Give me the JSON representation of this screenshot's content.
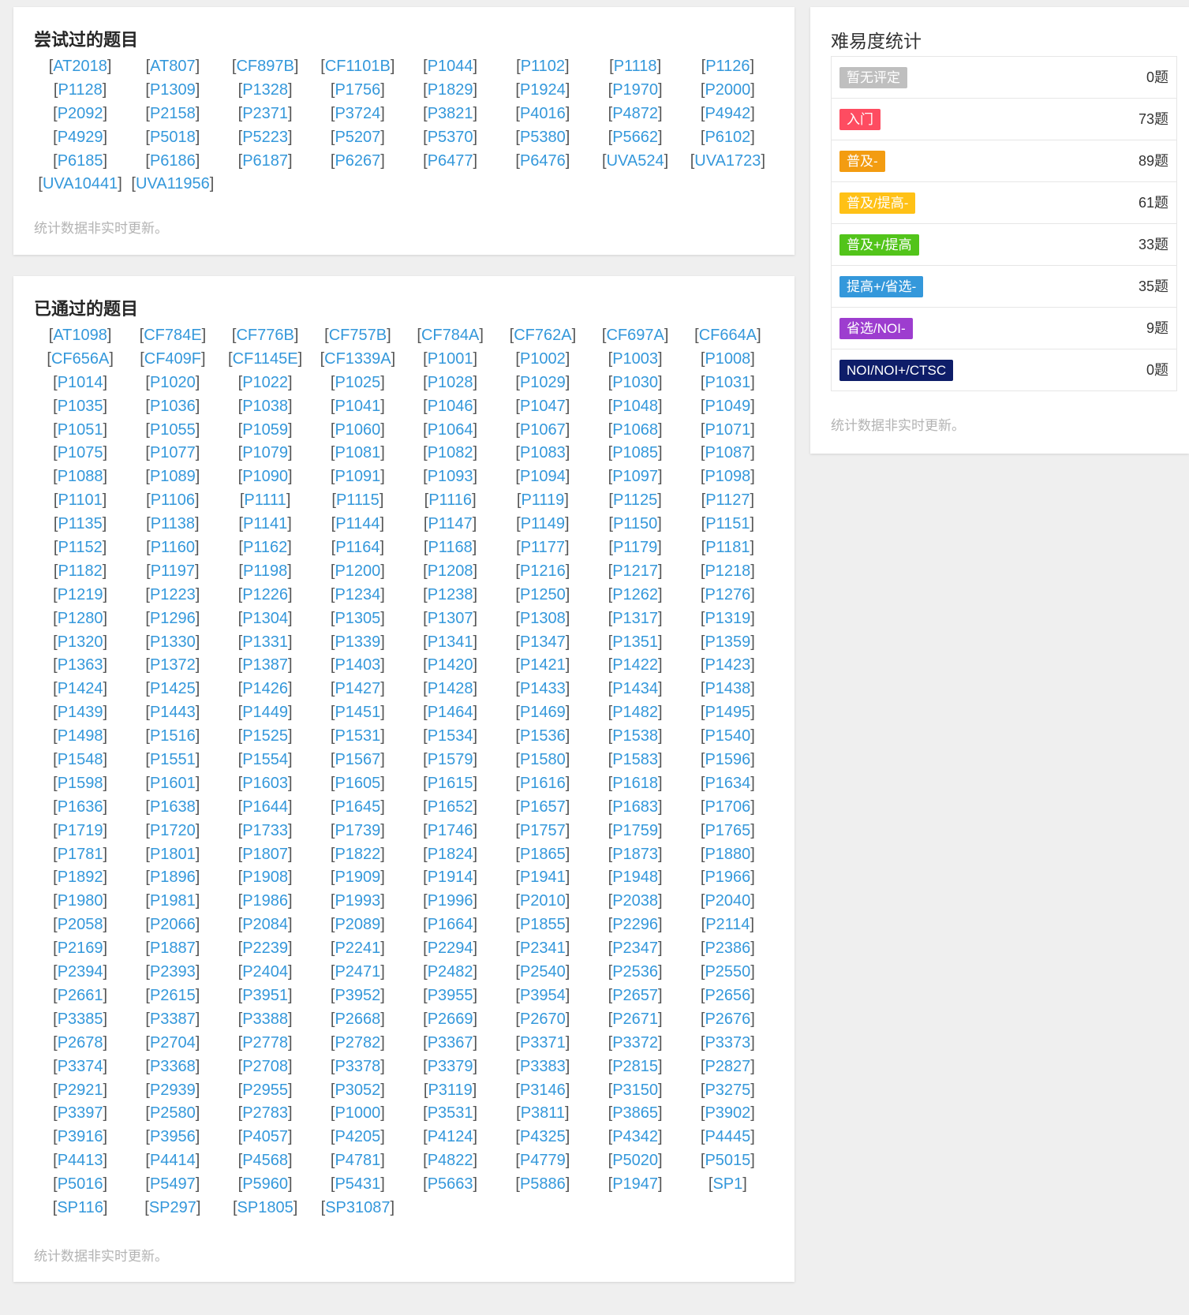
{
  "tried": {
    "title": "尝试过的题目",
    "note": "统计数据非实时更新。",
    "problems": [
      "AT2018",
      "AT807",
      "CF897B",
      "CF1101B",
      "P1044",
      "P1102",
      "P1118",
      "P1126",
      "P1128",
      "P1309",
      "P1328",
      "P1756",
      "P1829",
      "P1924",
      "P1970",
      "P2000",
      "P2092",
      "P2158",
      "P2371",
      "P3724",
      "P3821",
      "P4016",
      "P4872",
      "P4942",
      "P4929",
      "P5018",
      "P5223",
      "P5207",
      "P5370",
      "P5380",
      "P5662",
      "P6102",
      "P6185",
      "P6186",
      "P6187",
      "P6267",
      "P6477",
      "P6476",
      "UVA524",
      "UVA1723",
      "UVA10441",
      "UVA11956"
    ]
  },
  "passed": {
    "title": "已通过的题目",
    "note": "统计数据非实时更新。",
    "problems": [
      "AT1098",
      "CF784E",
      "CF776B",
      "CF757B",
      "CF784A",
      "CF762A",
      "CF697A",
      "CF664A",
      "CF656A",
      "CF409F",
      "CF1145E",
      "CF1339A",
      "P1001",
      "P1002",
      "P1003",
      "P1008",
      "P1014",
      "P1020",
      "P1022",
      "P1025",
      "P1028",
      "P1029",
      "P1030",
      "P1031",
      "P1035",
      "P1036",
      "P1038",
      "P1041",
      "P1046",
      "P1047",
      "P1048",
      "P1049",
      "P1051",
      "P1055",
      "P1059",
      "P1060",
      "P1064",
      "P1067",
      "P1068",
      "P1071",
      "P1075",
      "P1077",
      "P1079",
      "P1081",
      "P1082",
      "P1083",
      "P1085",
      "P1087",
      "P1088",
      "P1089",
      "P1090",
      "P1091",
      "P1093",
      "P1094",
      "P1097",
      "P1098",
      "P1101",
      "P1106",
      "P1111",
      "P1115",
      "P1116",
      "P1119",
      "P1125",
      "P1127",
      "P1135",
      "P1138",
      "P1141",
      "P1144",
      "P1147",
      "P1149",
      "P1150",
      "P1151",
      "P1152",
      "P1160",
      "P1162",
      "P1164",
      "P1168",
      "P1177",
      "P1179",
      "P1181",
      "P1182",
      "P1197",
      "P1198",
      "P1200",
      "P1208",
      "P1216",
      "P1217",
      "P1218",
      "P1219",
      "P1223",
      "P1226",
      "P1234",
      "P1238",
      "P1250",
      "P1262",
      "P1276",
      "P1280",
      "P1296",
      "P1304",
      "P1305",
      "P1307",
      "P1308",
      "P1317",
      "P1319",
      "P1320",
      "P1330",
      "P1331",
      "P1339",
      "P1341",
      "P1347",
      "P1351",
      "P1359",
      "P1363",
      "P1372",
      "P1387",
      "P1403",
      "P1420",
      "P1421",
      "P1422",
      "P1423",
      "P1424",
      "P1425",
      "P1426",
      "P1427",
      "P1428",
      "P1433",
      "P1434",
      "P1438",
      "P1439",
      "P1443",
      "P1449",
      "P1451",
      "P1464",
      "P1469",
      "P1482",
      "P1495",
      "P1498",
      "P1516",
      "P1525",
      "P1531",
      "P1534",
      "P1536",
      "P1538",
      "P1540",
      "P1548",
      "P1551",
      "P1554",
      "P1567",
      "P1579",
      "P1580",
      "P1583",
      "P1596",
      "P1598",
      "P1601",
      "P1603",
      "P1605",
      "P1615",
      "P1616",
      "P1618",
      "P1634",
      "P1636",
      "P1638",
      "P1644",
      "P1645",
      "P1652",
      "P1657",
      "P1683",
      "P1706",
      "P1719",
      "P1720",
      "P1733",
      "P1739",
      "P1746",
      "P1757",
      "P1759",
      "P1765",
      "P1781",
      "P1801",
      "P1807",
      "P1822",
      "P1824",
      "P1865",
      "P1873",
      "P1880",
      "P1892",
      "P1896",
      "P1908",
      "P1909",
      "P1914",
      "P1941",
      "P1948",
      "P1966",
      "P1980",
      "P1981",
      "P1986",
      "P1993",
      "P1996",
      "P2010",
      "P2038",
      "P2040",
      "P2058",
      "P2066",
      "P2084",
      "P2089",
      "P1664",
      "P1855",
      "P2296",
      "P2114",
      "P2169",
      "P1887",
      "P2239",
      "P2241",
      "P2294",
      "P2341",
      "P2347",
      "P2386",
      "P2394",
      "P2393",
      "P2404",
      "P2471",
      "P2482",
      "P2540",
      "P2536",
      "P2550",
      "P2661",
      "P2615",
      "P3951",
      "P3952",
      "P3955",
      "P3954",
      "P2657",
      "P2656",
      "P3385",
      "P3387",
      "P3388",
      "P2668",
      "P2669",
      "P2670",
      "P2671",
      "P2676",
      "P2678",
      "P2704",
      "P2778",
      "P2782",
      "P3367",
      "P3371",
      "P3372",
      "P3373",
      "P3374",
      "P3368",
      "P2708",
      "P3378",
      "P3379",
      "P3383",
      "P2815",
      "P2827",
      "P2921",
      "P2939",
      "P2955",
      "P3052",
      "P3119",
      "P3146",
      "P3150",
      "P3275",
      "P3397",
      "P2580",
      "P2783",
      "P1000",
      "P3531",
      "P3811",
      "P3865",
      "P3902",
      "P3916",
      "P3956",
      "P4057",
      "P4205",
      "P4124",
      "P4325",
      "P4342",
      "P4445",
      "P4413",
      "P4414",
      "P4568",
      "P4781",
      "P4822",
      "P4779",
      "P5020",
      "P5015",
      "P5016",
      "P5497",
      "P5960",
      "P5431",
      "P5663",
      "P5886",
      "P1947",
      "SP1",
      "SP116",
      "SP297",
      "SP1805",
      "SP31087"
    ]
  },
  "stats": {
    "title": "难易度统计",
    "note": "统计数据非实时更新。",
    "levels": [
      {
        "label": "暂无评定",
        "count": "0题",
        "color": "#bfbfbf"
      },
      {
        "label": "入门",
        "count": "73题",
        "color": "#fe4c61"
      },
      {
        "label": "普及-",
        "count": "89题",
        "color": "#f39c11"
      },
      {
        "label": "普及/提高-",
        "count": "61题",
        "color": "#ffc116"
      },
      {
        "label": "普及+/提高",
        "count": "33题",
        "color": "#52c41a"
      },
      {
        "label": "提高+/省选-",
        "count": "35题",
        "color": "#3498db"
      },
      {
        "label": "省选/NOI-",
        "count": "9题",
        "color": "#9d3dcf"
      },
      {
        "label": "NOI/NOI+/CTSC",
        "count": "0题",
        "color": "#0e1d69"
      }
    ]
  }
}
